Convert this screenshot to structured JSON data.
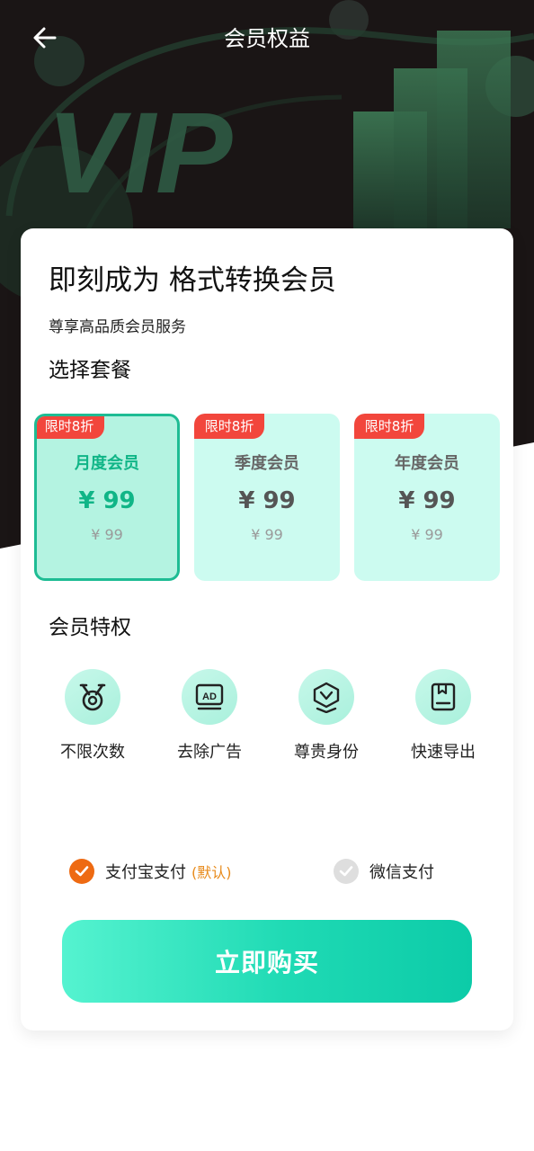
{
  "header": {
    "title": "会员权益",
    "back_icon": "arrow-left-icon"
  },
  "hero": {
    "watermark": "VIP"
  },
  "card": {
    "headline": "即刻成为 格式转换会员",
    "subline": "尊享高品质会员服务",
    "plans_title": "选择套餐",
    "plans": [
      {
        "badge": "限时8折",
        "name": "月度会员",
        "price": "¥ 99",
        "original_price": "¥ 99",
        "selected": true
      },
      {
        "badge": "限时8折",
        "name": "季度会员",
        "price": "¥ 99",
        "original_price": "¥ 99",
        "selected": false
      },
      {
        "badge": "限时8折",
        "name": "年度会员",
        "price": "¥ 99",
        "original_price": "¥ 99",
        "selected": false
      }
    ],
    "perks_title": "会员特权",
    "perks": [
      {
        "icon": "medal-icon",
        "label": "不限次数"
      },
      {
        "icon": "ad-icon",
        "label": "去除广告"
      },
      {
        "icon": "vip-shield-icon",
        "label": "尊贵身份"
      },
      {
        "icon": "export-book-icon",
        "label": "快速导出"
      }
    ],
    "payment": {
      "alipay": {
        "label": "支付宝支付",
        "default_tag": "(默认)",
        "selected": true
      },
      "wechat": {
        "label": "微信支付",
        "selected": false
      }
    },
    "buy_button": "立即购买"
  },
  "colors": {
    "accent": "#10b587",
    "badge": "#f2463c",
    "alipay_check": "#ee6a12",
    "hero_bg": "#1a1515"
  }
}
